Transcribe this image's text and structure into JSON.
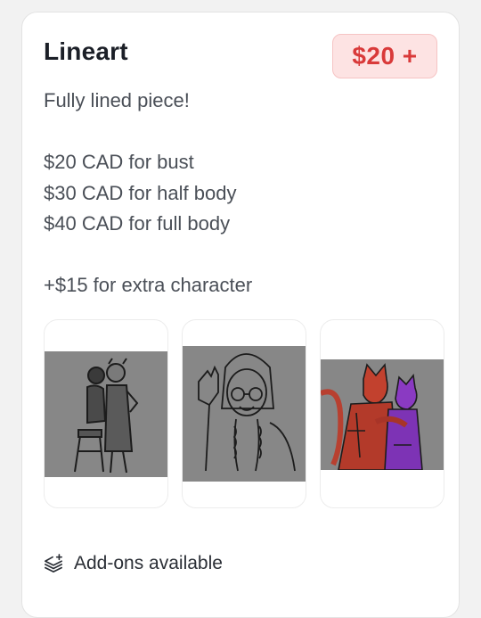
{
  "card": {
    "title": "Lineart",
    "price_badge": "$20 +",
    "description": {
      "intro": "Fully lined piece!",
      "prices": [
        "$20 CAD for bust",
        "$30 CAD for half body",
        "$40 CAD for full body"
      ],
      "extra": "+$15 for extra character"
    },
    "gallery": [
      {
        "icon": "sketch-two-characters-chair"
      },
      {
        "icon": "sketch-girl-with-glasses-waving"
      },
      {
        "icon": "sketch-red-and-purple-characters-hugging"
      }
    ],
    "addons": {
      "icon": "layers-plus-icon",
      "label": "Add-ons available"
    }
  },
  "colors": {
    "price_text": "#d93a3a",
    "price_bg": "#fde3e3",
    "title_text": "#1b1f27",
    "body_text": "#4a4f57"
  }
}
